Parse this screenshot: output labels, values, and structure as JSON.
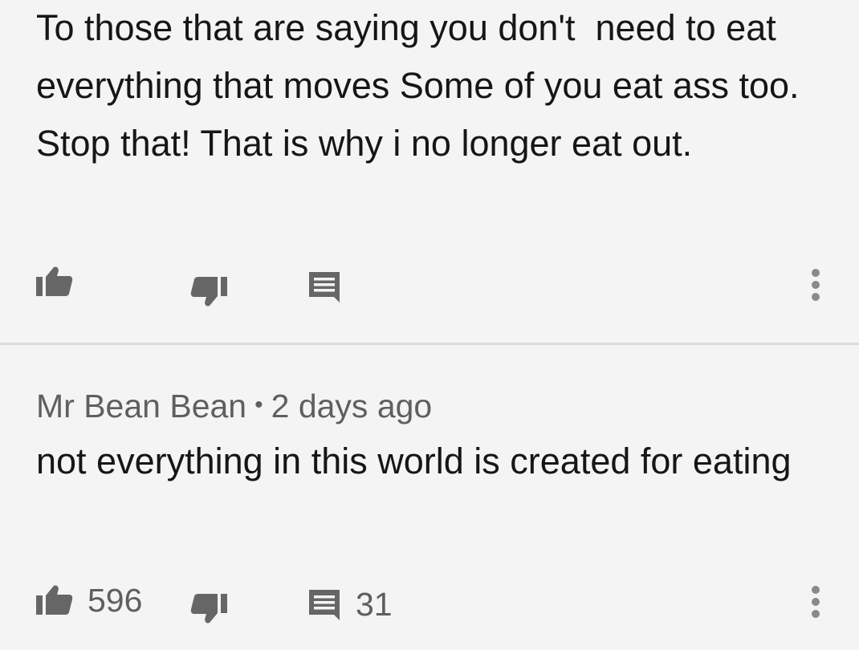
{
  "comments": [
    {
      "text": "To those that are saying you don't  need to eat everything that moves Some of you eat ass too. Stop that! That is why i no longer eat out.",
      "like_count": "",
      "reply_count": ""
    },
    {
      "author": "Mr Bean Bean",
      "separator": "•",
      "time": "2 days ago",
      "text": "not everything in this world is created for eating",
      "like_count": "596",
      "reply_count": "31"
    }
  ],
  "icons": {
    "like": "thumbs-up-icon",
    "dislike": "thumbs-down-icon",
    "reply": "comment-icon",
    "more": "more-vert-icon"
  },
  "colors": {
    "background": "#f4f4f4",
    "text": "#161616",
    "secondary_text": "#5f5f5f",
    "icon": "#666666",
    "divider": "#dcdcdc"
  }
}
